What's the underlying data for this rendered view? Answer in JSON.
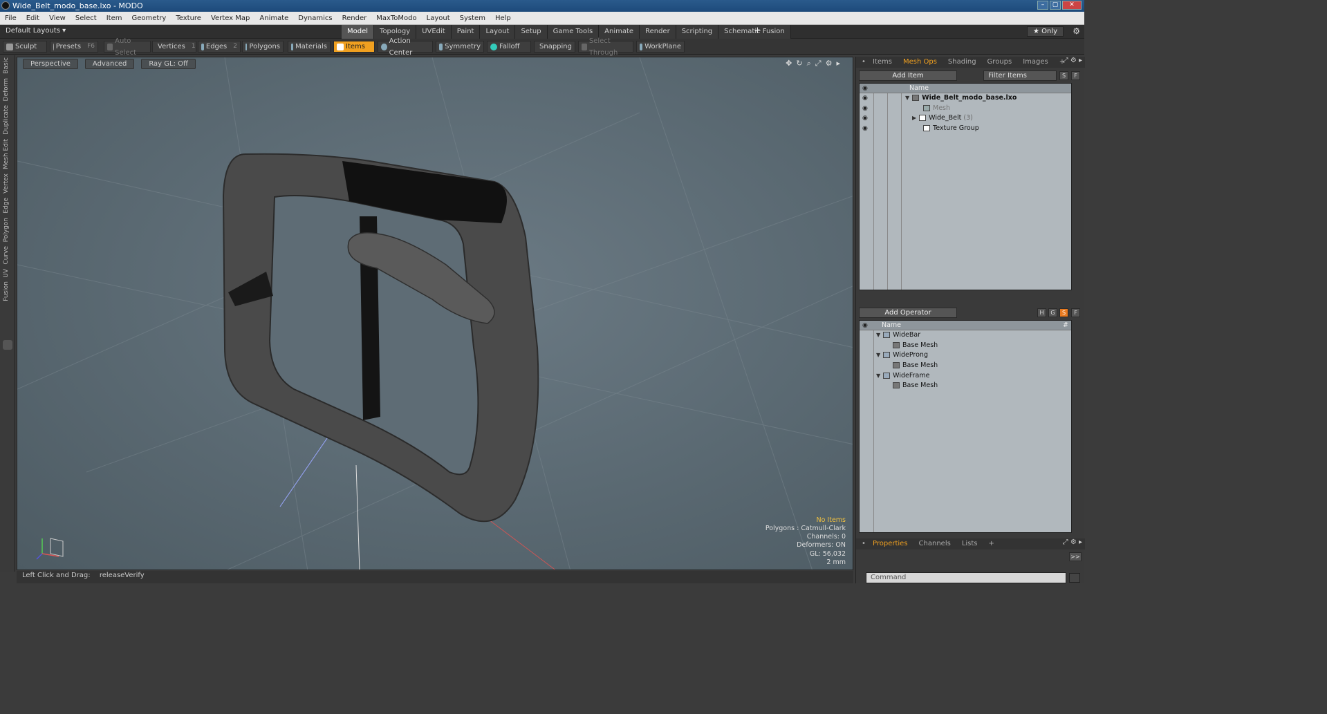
{
  "window": {
    "title": "Wide_Belt_modo_base.lxo - MODO",
    "btn_min": "–",
    "btn_max": "▢",
    "btn_close": "✕"
  },
  "menu": [
    "File",
    "Edit",
    "View",
    "Select",
    "Item",
    "Geometry",
    "Texture",
    "Vertex Map",
    "Animate",
    "Dynamics",
    "Render",
    "MaxToModo",
    "Layout",
    "System",
    "Help"
  ],
  "layoutbar": {
    "layout_select": "Default Layouts ▾",
    "tabs": [
      "Model",
      "Topology",
      "UVEdit",
      "Paint",
      "Layout",
      "Setup",
      "Game Tools",
      "Animate",
      "Render",
      "Scripting",
      "Schematic Fusion"
    ],
    "active_tab": "Model",
    "plus": "+",
    "only": "★ Only",
    "gear": "⚙"
  },
  "toolbar": {
    "sculpt": "Sculpt",
    "presets": "Presets",
    "presets_key": "F6",
    "auto_select": "Auto Select",
    "vertices": "Vertices",
    "vertices_key": "1",
    "edges": "Edges",
    "edges_key": "2",
    "polygons": "Polygons",
    "materials": "Materials",
    "items": "Items",
    "action_center": "Action Center",
    "symmetry": "Symmetry",
    "falloff": "Falloff",
    "snapping": "Snapping",
    "select_through": "Select Through",
    "workplane": "WorkPlane"
  },
  "left_tabs": [
    "Basic",
    "Deform",
    "Duplicate",
    "Mesh Edit",
    "Vertex",
    "Edge",
    "Polygon",
    "Curve",
    "UV",
    "Fusion"
  ],
  "viewport": {
    "perspective": "Perspective",
    "advanced": "Advanced",
    "raygl": "Ray GL: Off",
    "info": {
      "no_items": "No Items",
      "polygons": "Polygons : Catmull-Clark",
      "channels": "Channels: 0",
      "deformers": "Deformers: ON",
      "gl": "GL: 56,032",
      "scale": "2 mm"
    }
  },
  "status": {
    "label": "Left Click and Drag:",
    "value": "releaseVerify"
  },
  "items_panel": {
    "tabs": [
      "Items",
      "Mesh Ops",
      "Shading",
      "Groups",
      "Images",
      "+"
    ],
    "active_tab": "Mesh Ops",
    "add_item": "Add Item",
    "filter": "Filter Items",
    "s_btn": "S",
    "f_btn": "F",
    "col_name": "Name",
    "rows": [
      {
        "label": "Wide_Belt_modo_base.lxo",
        "count": ""
      },
      {
        "label": "Mesh",
        "count": ""
      },
      {
        "label": "Wide_Belt",
        "count": "(3)"
      },
      {
        "label": "Texture Group",
        "count": ""
      }
    ]
  },
  "meshops_panel": {
    "add_operator": "Add Operator",
    "btn_h": "H",
    "btn_g": "G",
    "btn_s": "S",
    "btn_f": "F",
    "col_name": "Name",
    "col_hash": "#",
    "rows": [
      {
        "label": "WideBar"
      },
      {
        "label": "Base Mesh"
      },
      {
        "label": "WideProng"
      },
      {
        "label": "Base Mesh"
      },
      {
        "label": "WideFrame"
      },
      {
        "label": "Base Mesh"
      }
    ]
  },
  "properties_panel": {
    "tabs": [
      "Properties",
      "Channels",
      "Lists",
      "+"
    ],
    "active_tab": "Properties",
    "expand": ">>"
  },
  "command": {
    "placeholder": "Command"
  }
}
